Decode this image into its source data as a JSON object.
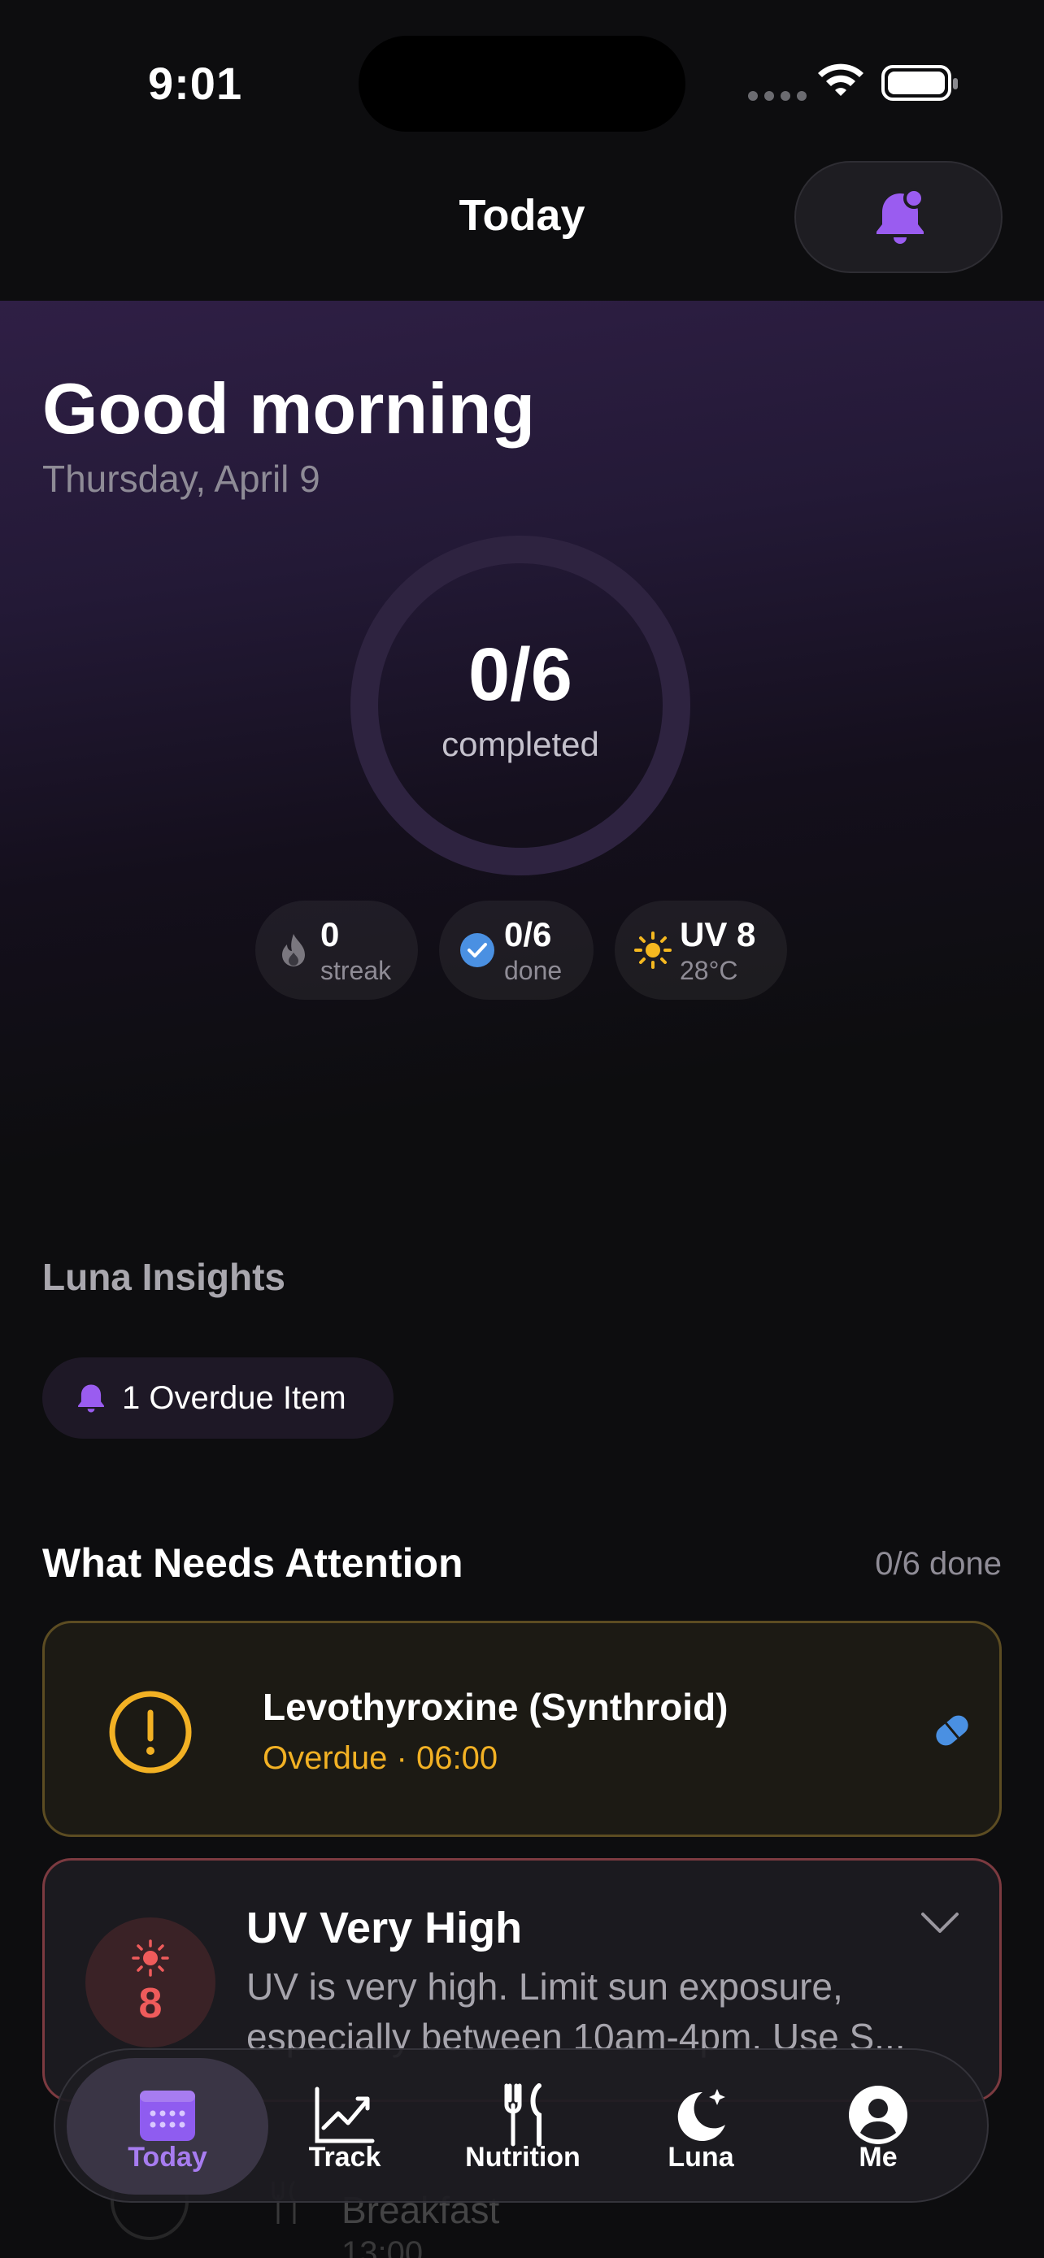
{
  "status_bar": {
    "time": "9:01"
  },
  "header": {
    "title": "Today",
    "notification_icon": "bell-icon"
  },
  "hero": {
    "greeting": "Good morning",
    "date": "Thursday, April 9",
    "progress": {
      "value_text": "0/6",
      "label": "completed",
      "completed": 0,
      "total": 6
    },
    "chips": [
      {
        "icon": "flame-icon",
        "value": "0",
        "label": "streak"
      },
      {
        "icon": "check-circle-icon",
        "value": "0/6",
        "label": "done"
      },
      {
        "icon": "sun-icon",
        "value": "UV 8",
        "label": "28°C"
      }
    ]
  },
  "insights": {
    "title": "Luna Insights",
    "pill_label": "1 Overdue Item"
  },
  "attention": {
    "title": "What Needs Attention",
    "count": "0/6 done",
    "medication": {
      "name": "Levothyroxine (Synthroid)",
      "status": "Overdue · 06:00"
    },
    "uv_alert": {
      "badge_value": "8",
      "title": "UV Very High",
      "text": "UV is very high. Limit sun exposure, especially between 10am-4pm. Use S..."
    },
    "next_item": {
      "label": "Breakfast",
      "time": "13:00"
    }
  },
  "tabs": [
    {
      "label": "Today",
      "icon": "calendar-icon",
      "active": true
    },
    {
      "label": "Track",
      "icon": "chart-icon",
      "active": false
    },
    {
      "label": "Nutrition",
      "icon": "fork-knife-icon",
      "active": false
    },
    {
      "label": "Luna",
      "icon": "moon-icon",
      "active": false
    },
    {
      "label": "Me",
      "icon": "person-icon",
      "active": false
    }
  ],
  "colors": {
    "accent": "#a77cf0",
    "warning": "#f2b124",
    "danger": "#ef5b5b",
    "info": "#4a90e2"
  }
}
